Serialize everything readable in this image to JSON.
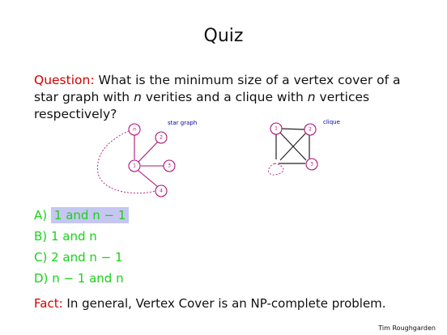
{
  "slide": {
    "title": "Quiz",
    "question_label": "Question:",
    "question_text": "What is the minimum size of a vertex cover of a star graph with",
    "question_n1": "n",
    "question_mid": "verities and a clique with",
    "question_n2": "n",
    "question_end": "vertices respectively?",
    "star_graph_label": "star graph",
    "clique_label": "clique",
    "star_nodes": [
      "n",
      "2",
      "1",
      "3",
      "4"
    ],
    "clique_nodes": [
      "1",
      "2",
      "3"
    ],
    "answers": [
      {
        "letter": "A)",
        "text": "1 and n − 1",
        "highlighted": true
      },
      {
        "letter": "B)",
        "text": "1 and n",
        "highlighted": false
      },
      {
        "letter": "C)",
        "text": "2 and n − 1",
        "highlighted": false
      },
      {
        "letter": "D)",
        "text": "n − 1 and n",
        "highlighted": false
      }
    ],
    "fact_label": "Fact:",
    "fact_text": "In general, Vertex Cover is an NP-complete problem.",
    "author": "Tim Roughgarden",
    "colors": {
      "label_red": "#d40000",
      "answer_green": "#19d219",
      "highlight": "#c6c6f2",
      "node_magenta": "#b0127a",
      "graph_label_blue": "#0000aa"
    }
  }
}
